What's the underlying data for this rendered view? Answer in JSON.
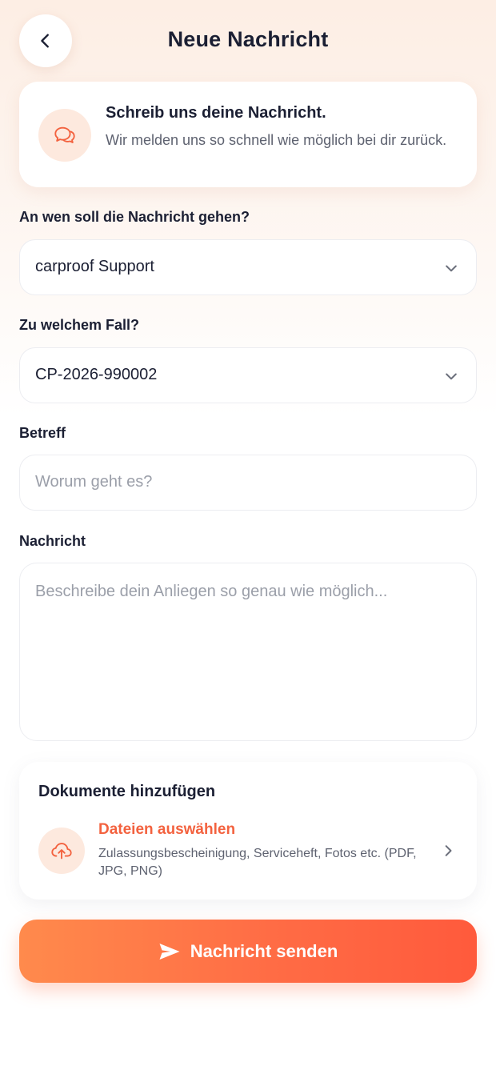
{
  "header": {
    "title": "Neue Nachricht",
    "back_icon": "chevron-left-icon"
  },
  "info_card": {
    "icon": "chat-bubbles-icon",
    "title": "Schreib uns deine Nachricht.",
    "subtitle": "Wir melden uns so schnell wie möglich bei dir zurück."
  },
  "form": {
    "recipient": {
      "label": "An wen soll die Nachricht gehen?",
      "value": "carproof Support"
    },
    "case": {
      "label": "Zu welchem Fall?",
      "value": "CP-2026-990002"
    },
    "subject": {
      "label": "Betreff",
      "value": "",
      "placeholder": "Worum geht es?"
    },
    "message": {
      "label": "Nachricht",
      "value": "",
      "placeholder": "Beschreibe dein Anliegen so genau wie möglich..."
    }
  },
  "documents": {
    "title": "Dokumente hinzufügen",
    "upload_title": "Dateien auswählen",
    "upload_hint": "Zulassungsbescheinigung, Serviceheft, Fotos etc. (PDF, JPG, PNG)",
    "upload_icon": "cloud-upload-icon"
  },
  "send_button": {
    "label": "Nachricht senden",
    "icon": "send-icon"
  },
  "colors": {
    "accent": "#f3623f",
    "accent_soft": "#fde9de",
    "text": "#1b1f33",
    "muted": "#5e6270",
    "placeholder": "#9b9fa9",
    "button_gradient_start": "#ff8a4c",
    "button_gradient_end": "#ff5a3c"
  }
}
